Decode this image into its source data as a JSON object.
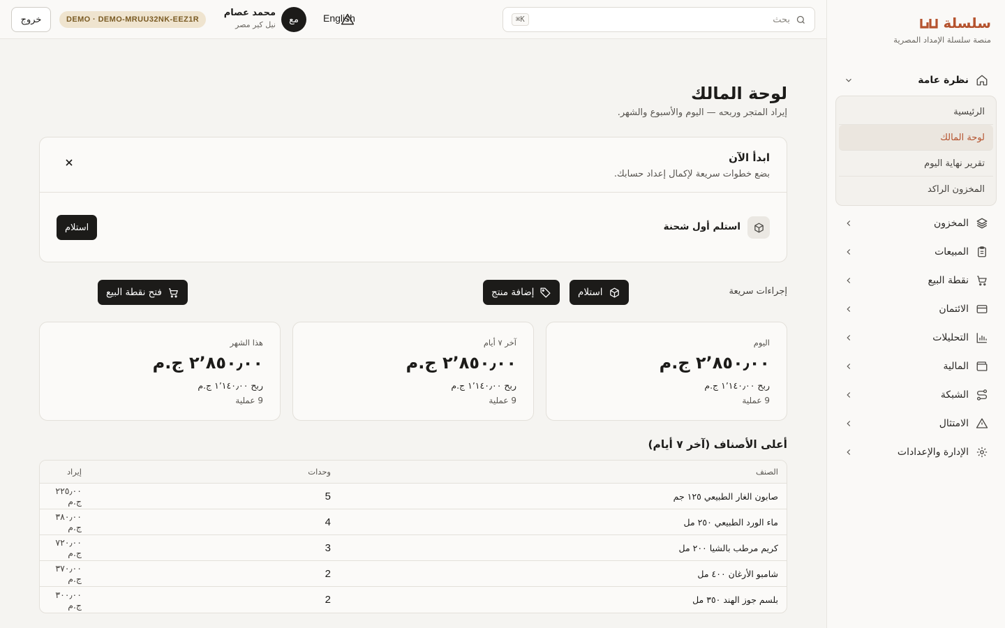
{
  "brand": {
    "name": "سلسلة",
    "tagline": "منصة سلسلة الإمداد المصرية",
    "color": "#b5532e"
  },
  "sidebar": {
    "groups": [
      {
        "label": "نظرة عامة",
        "icon": "home-icon",
        "expanded": true,
        "children": [
          {
            "label": "الرئيسية",
            "active": false
          },
          {
            "label": "لوحة المالك",
            "active": true
          },
          {
            "label": "تقرير نهاية اليوم",
            "active": false
          },
          {
            "label": "المخزون الراكد",
            "active": false
          }
        ]
      },
      {
        "label": "المخزون",
        "icon": "layers-icon"
      },
      {
        "label": "المبيعات",
        "icon": "clipboard-icon"
      },
      {
        "label": "نقطة البيع",
        "icon": "cart-icon"
      },
      {
        "label": "الائتمان",
        "icon": "credit-card-icon"
      },
      {
        "label": "التحليلات",
        "icon": "bar-chart-icon"
      },
      {
        "label": "المالية",
        "icon": "wallet-icon"
      },
      {
        "label": "الشبكة",
        "icon": "route-icon"
      },
      {
        "label": "الامتثال",
        "icon": "warning-icon"
      },
      {
        "label": "الإدارة والإعدادات",
        "icon": "gear-icon"
      }
    ]
  },
  "topbar": {
    "search_placeholder": "بحث",
    "search_shortcut": "⌘K",
    "language": "English",
    "avatar_initials": "مع",
    "user_name": "محمد عصام",
    "store_name": "نيل كير مصر",
    "demo_badge": "DEMO · DEMO-MRUU32NK-EEZ1R",
    "logout": "خروج"
  },
  "page": {
    "title": "لوحة المالك",
    "subtitle": "إيراد المتجر وربحه — اليوم والأسبوع والشهر."
  },
  "onboarding": {
    "title": "ابدأ الآن",
    "subtitle": "بضع خطوات سريعة لإكمال إعداد حسابك.",
    "step_label": "استلم أول شحنة",
    "step_icon": "box-icon",
    "step_button": "استلام"
  },
  "quick_actions": {
    "label": "إجراءات سريعة",
    "buttons": [
      {
        "label": "فتح نقطة البيع",
        "icon": "cart-icon"
      },
      {
        "label": "استلام",
        "icon": "box-icon"
      },
      {
        "label": "إضافة منتج",
        "icon": "tag-icon"
      }
    ]
  },
  "stats": [
    {
      "label": "اليوم",
      "value": "٢٬٨٥٠٫٠٠ ج.م",
      "profit": "ربح ١٬١٤٠٫٠٠ ج.م",
      "ops": "9 عملية"
    },
    {
      "label": "آخر ٧ أيام",
      "value": "٢٬٨٥٠٫٠٠ ج.م",
      "profit": "ربح ١٬١٤٠٫٠٠ ج.م",
      "ops": "9 عملية"
    },
    {
      "label": "هذا الشهر",
      "value": "٢٬٨٥٠٫٠٠ ج.م",
      "profit": "ربح ١٬١٤٠٫٠٠ ج.م",
      "ops": "9 عملية"
    }
  ],
  "top_items": {
    "title": "أعلى الأصناف (آخر ٧ أيام)",
    "columns": [
      "الصنف",
      "وحدات",
      "إيراد"
    ],
    "rows": [
      {
        "name": "صابون الغار الطبيعي ١٢٥ جم",
        "units": "5",
        "revenue": "٢٢٥٫٠٠ ج.م"
      },
      {
        "name": "ماء الورد الطبيعي ٢٥٠ مل",
        "units": "4",
        "revenue": "٣٨٠٫٠٠ ج.م"
      },
      {
        "name": "كريم مرطب بالشيا ٢٠٠ مل",
        "units": "3",
        "revenue": "٧٢٠٫٠٠ ج.م"
      },
      {
        "name": "شامبو الأرغان ٤٠٠ مل",
        "units": "2",
        "revenue": "٣٧٠٫٠٠ ج.م"
      },
      {
        "name": "بلسم جوز الهند ٣٥٠ مل",
        "units": "2",
        "revenue": "٣٠٠٫٠٠ ج.م"
      }
    ]
  }
}
